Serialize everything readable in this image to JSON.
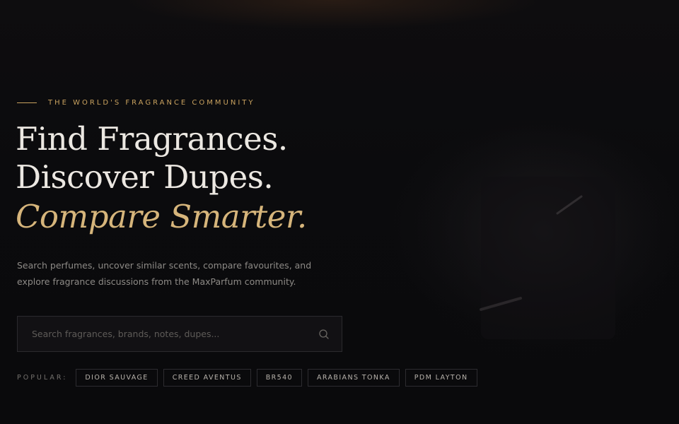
{
  "hero": {
    "kicker": "THE WORLD'S FRAGRANCE COMMUNITY",
    "headline": {
      "line1": "Find Fragrances.",
      "line2": "Discover Dupes.",
      "line3": "Compare Smarter."
    },
    "subcopy": "Search perfumes, uncover similar scents, compare favourites, and explore fragrance discussions from the MaxParfum community."
  },
  "search": {
    "value": "",
    "placeholder": "Search fragrances, brands, notes, dupes...",
    "icon": "search-icon"
  },
  "popular": {
    "label": "POPULAR:",
    "chips": [
      "DIOR SAUVAGE",
      "CREED AVENTUS",
      "BR540",
      "ARABIANS TONKA",
      "PDM LAYTON"
    ]
  },
  "colors": {
    "accent": "#c9a25f",
    "accent_light": "#d6b57b",
    "heading": "#ece8e2",
    "body_text": "#8d8a86",
    "background": "#0b0b0d"
  }
}
